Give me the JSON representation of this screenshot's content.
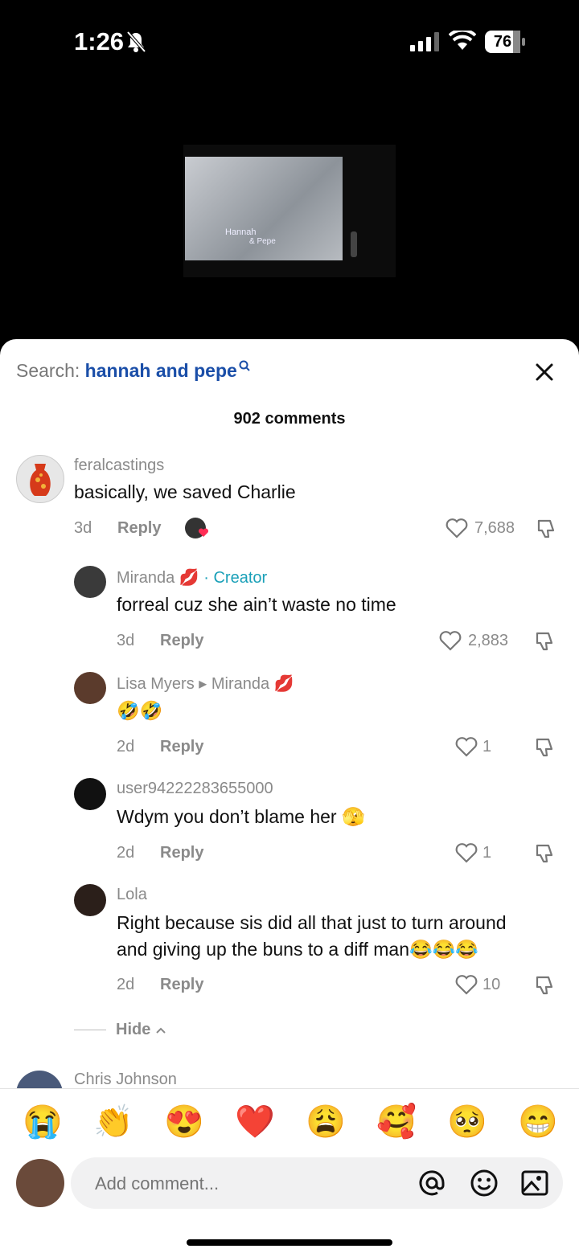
{
  "status_bar": {
    "time": "1:26",
    "battery": "76"
  },
  "video": {
    "caption_line1": "Hannah",
    "caption_line2": "& Pepe"
  },
  "search": {
    "prefix": "Search: ",
    "query": "hannah and pepe"
  },
  "comments_count": "902 comments",
  "comments": [
    {
      "username": "feralcastings",
      "text": "basically, we saved Charlie",
      "age": "3d",
      "reply": "Reply",
      "likes": "7,688"
    },
    {
      "username": "Miranda 💋",
      "badge": " · Creator",
      "text": "forreal cuz she ain’t waste no time",
      "age": "3d",
      "reply": "Reply",
      "likes": "2,883"
    },
    {
      "username": "Lisa Myers",
      "reply_to": "▸ Miranda 💋",
      "text": "🤣🤣",
      "age": "2d",
      "reply": "Reply",
      "likes": "1"
    },
    {
      "username": "user94222283655000",
      "text": "Wdym you don’t blame her 🫣",
      "age": "2d",
      "reply": "Reply",
      "likes": "1"
    },
    {
      "username": "Lola",
      "text_line1": "Right because sis did all that just to turn around",
      "text_line2": "and giving up the buns to a diff man😂😂😂",
      "age": "2d",
      "reply": "Reply",
      "likes": "10"
    },
    {
      "username": "Chris Johnson"
    }
  ],
  "hide_label": "Hide",
  "quick_emojis": [
    "😭",
    "👏",
    "😍",
    "❤️",
    "😩",
    "🥰",
    "🥺",
    "😁"
  ],
  "comment_input": {
    "placeholder": "Add comment..."
  },
  "icons": {
    "mention": "at-icon",
    "emoji": "smiley-icon",
    "image": "image-icon"
  }
}
